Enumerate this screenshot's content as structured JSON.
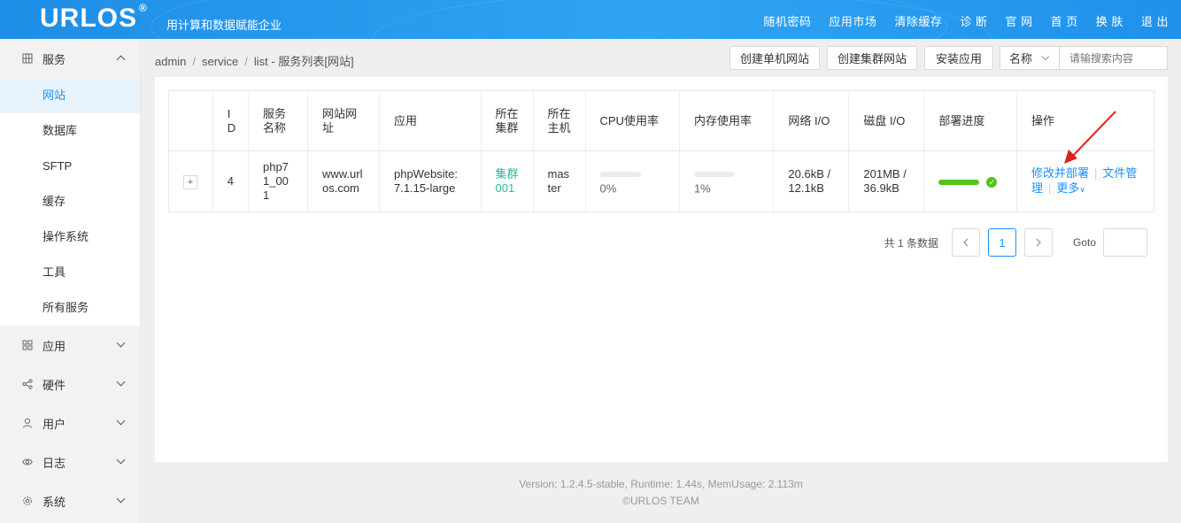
{
  "header": {
    "logo": "URLOS",
    "logo_mark": "®",
    "slogan": "用计算和数据赋能企业",
    "nav": [
      "随机密码",
      "应用市场",
      "清除缓存",
      "诊 断",
      "官 网",
      "首 页",
      "换 肤",
      "退 出"
    ]
  },
  "sidebar": {
    "service": {
      "label": "服务",
      "icon": "grid-icon",
      "items": [
        "网站",
        "数据库",
        "SFTP",
        "缓存",
        "操作系统",
        "工具",
        "所有服务"
      ],
      "active": "网站"
    },
    "groups": [
      {
        "label": "应用",
        "icon": "apps-icon"
      },
      {
        "label": "硬件",
        "icon": "share-icon"
      },
      {
        "label": "用户",
        "icon": "user-icon"
      },
      {
        "label": "日志",
        "icon": "eye-icon"
      },
      {
        "label": "系统",
        "icon": "gear-icon"
      }
    ]
  },
  "breadcrumb": {
    "parts": [
      "admin",
      "service",
      "list"
    ],
    "title": "服务列表[网站]"
  },
  "toolbar": {
    "create_single": "创建单机网站",
    "create_cluster": "创建集群网站",
    "install_app": "安装应用",
    "filter_select": "名称",
    "search_placeholder": "请输搜索内容"
  },
  "table": {
    "headers": [
      "I D",
      "服务名称",
      "网站网址",
      "应用",
      "所在集群",
      "所在主机",
      "CPU使用率",
      "内存使用率",
      "网络 I/O",
      "磁盘 I/O",
      "部署进度",
      "操作"
    ],
    "rows": [
      {
        "expand": "+",
        "id": "4",
        "name": "php71_001",
        "url": "www.urlos.com",
        "app": "phpWebsite:7.1.15-large",
        "cluster": "集群001",
        "host": "master",
        "cpu": "0%",
        "mem": "1%",
        "net": "20.6kB / 12.1kB",
        "disk": "201MB / 36.9kB",
        "deploy_progress": 1.0,
        "actions": {
          "edit": "修改并部署",
          "files": "文件管理",
          "more": "更多"
        }
      }
    ]
  },
  "pagination": {
    "total": "共 1 条数据",
    "current": "1",
    "goto": "Goto"
  },
  "footer": {
    "line1": "Version: 1.2.4.5-stable,   Runtime: 1.44s,   MemUsage: 2.113m",
    "line2": "©URLOS TEAM"
  },
  "colors": {
    "header": "#2196f3",
    "accent": "#1890ff",
    "success": "#52c41a",
    "annotation_arrow": "#e02020"
  }
}
